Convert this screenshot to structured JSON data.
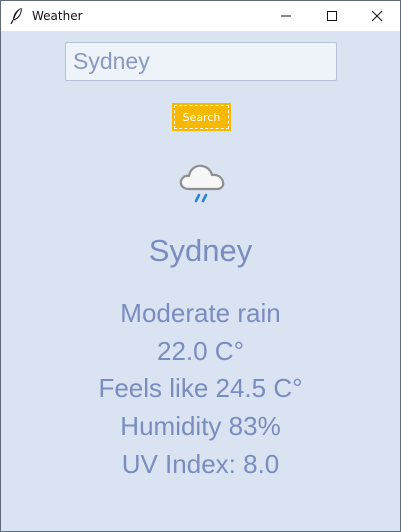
{
  "window": {
    "title": "Weather",
    "icon": "feather-icon",
    "controls": [
      "minimize-icon",
      "maximize-icon",
      "close-icon"
    ]
  },
  "search": {
    "value": "Sydney",
    "button_label": "Search"
  },
  "weather": {
    "icon": "cloud-rain-icon",
    "city": "Sydney",
    "condition": "Moderate rain",
    "temperature": "22.0 C°",
    "feels_like": "Feels like 24.5 C°",
    "humidity": "Humidity 83%",
    "uv_index": "UV Index: 8.0"
  },
  "colors": {
    "background": "#dae3f2",
    "text": "#7b8cbf",
    "button": "#f6b800",
    "input_background": "#eef3f9"
  }
}
